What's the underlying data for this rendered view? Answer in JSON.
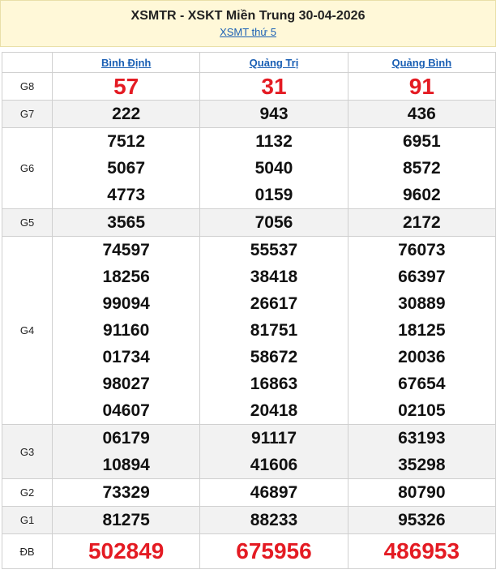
{
  "header": {
    "title": "XSMTR - XSKT Miền Trung 30-04-2026",
    "subtitle": "XSMT thứ 5"
  },
  "provinces": [
    "Bình Định",
    "Quảng Trị",
    "Quảng Bình"
  ],
  "prizes": {
    "G8": {
      "label": "G8",
      "values": [
        [
          "57"
        ],
        [
          "31"
        ],
        [
          "91"
        ]
      ]
    },
    "G7": {
      "label": "G7",
      "values": [
        [
          "222"
        ],
        [
          "943"
        ],
        [
          "436"
        ]
      ]
    },
    "G6": {
      "label": "G6",
      "values": [
        [
          "7512",
          "5067",
          "4773"
        ],
        [
          "1132",
          "5040",
          "0159"
        ],
        [
          "6951",
          "8572",
          "9602"
        ]
      ]
    },
    "G5": {
      "label": "G5",
      "values": [
        [
          "3565"
        ],
        [
          "7056"
        ],
        [
          "2172"
        ]
      ]
    },
    "G4": {
      "label": "G4",
      "values": [
        [
          "74597",
          "18256",
          "99094",
          "91160",
          "01734",
          "98027",
          "04607"
        ],
        [
          "55537",
          "38418",
          "26617",
          "81751",
          "58672",
          "16863",
          "20418"
        ],
        [
          "76073",
          "66397",
          "30889",
          "18125",
          "20036",
          "67654",
          "02105"
        ]
      ]
    },
    "G3": {
      "label": "G3",
      "values": [
        [
          "06179",
          "10894"
        ],
        [
          "91117",
          "41606"
        ],
        [
          "63193",
          "35298"
        ]
      ]
    },
    "G2": {
      "label": "G2",
      "values": [
        [
          "73329"
        ],
        [
          "46897"
        ],
        [
          "80790"
        ]
      ]
    },
    "G1": {
      "label": "G1",
      "values": [
        [
          "81275"
        ],
        [
          "88233"
        ],
        [
          "95326"
        ]
      ]
    },
    "DB": {
      "label": "ĐB",
      "values": [
        [
          "502849"
        ],
        [
          "675956"
        ],
        [
          "486953"
        ]
      ]
    }
  }
}
